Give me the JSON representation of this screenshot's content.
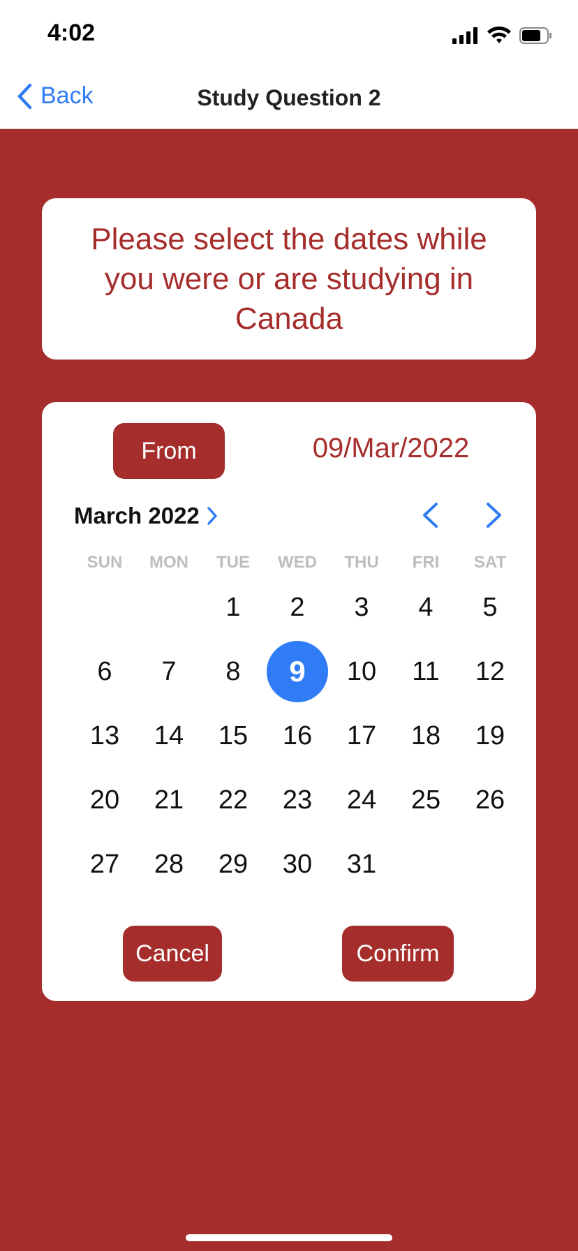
{
  "status_bar": {
    "time": "4:02"
  },
  "nav": {
    "back_label": "Back",
    "title": "Study Question 2"
  },
  "question": {
    "text": "Please select the dates while you were or are studying in Canada"
  },
  "picker": {
    "from_label": "From",
    "selected_date": "09/Mar/2022",
    "month_label": "March 2022",
    "weekdays": [
      "SUN",
      "MON",
      "TUE",
      "WED",
      "THU",
      "FRI",
      "SAT"
    ],
    "first_weekday_index": 2,
    "days_in_month": 31,
    "selected_day": 9,
    "cancel_label": "Cancel",
    "confirm_label": "Confirm"
  },
  "colors": {
    "brand": "#a52d2c",
    "accent": "#2f7cf6",
    "weekday_text": "#bdbdbd"
  }
}
